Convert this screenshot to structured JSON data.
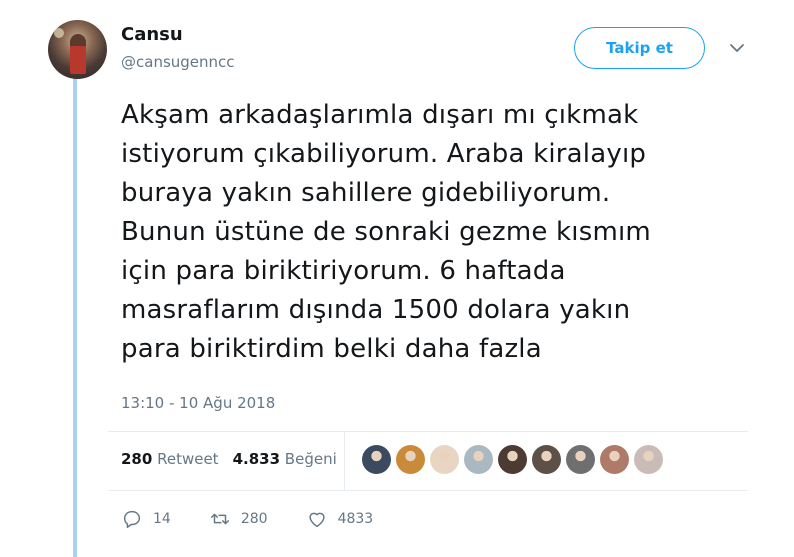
{
  "user": {
    "display_name": "Cansu",
    "handle": "@cansugenncc",
    "avatar_icon": "profile-photo"
  },
  "follow_button_label": "Takip et",
  "menu_icon": "chevron-down-icon",
  "tweet": {
    "text_lines": [
      "Akşam arkadaşlarımla dışarı mı çıkmak",
      "istiyorum çıkabiliyorum. Araba kiralayıp",
      "buraya yakın sahillere gidebiliyorum.",
      "Bunun üstüne de sonraki gezme kısmım",
      "için para biriktiriyorum. 6 haftada",
      "masraflarım dışında 1500 dolara yakın",
      "para biriktirdim belki daha fazla"
    ],
    "timestamp": "13:10 - 10 Ağu 2018"
  },
  "stats": {
    "retweet_count": "280",
    "retweet_label": "Retweet",
    "like_count": "4.833",
    "like_label": "Beğeni"
  },
  "liker_avatars": [
    {
      "color": "#3b4a5e"
    },
    {
      "color": "#c98b3a"
    },
    {
      "color": "#e9d6c2"
    },
    {
      "color": "#aab8c2"
    },
    {
      "color": "#4b3b33"
    },
    {
      "color": "#5d5147"
    },
    {
      "color": "#6f6f6f"
    },
    {
      "color": "#b07a6a"
    },
    {
      "color": "#c9bcb8"
    }
  ],
  "actions": {
    "reply_count": "14",
    "retweet_count": "280",
    "like_count": "4833"
  },
  "colors": {
    "accent": "#1da1f2",
    "thread_line": "#a9d3f3",
    "secondary_text": "#657786"
  }
}
